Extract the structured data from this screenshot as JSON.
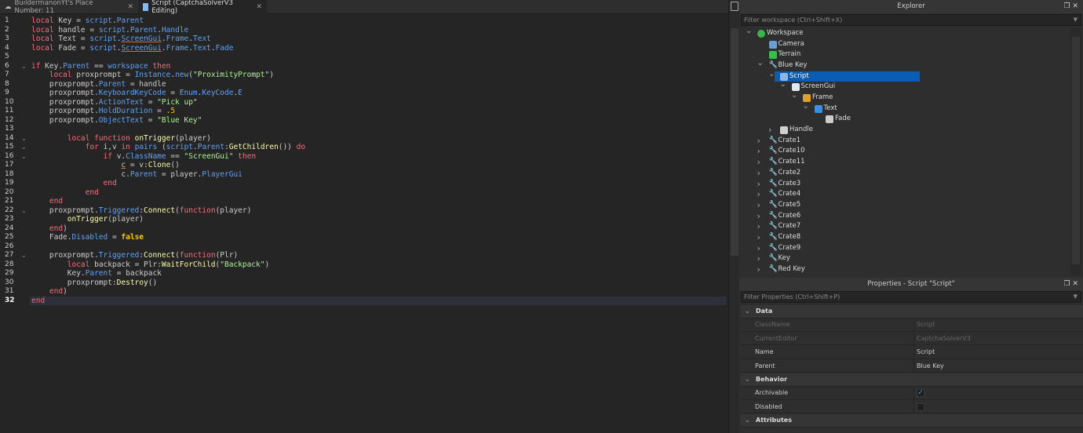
{
  "tabs": [
    {
      "label": "BuildermanonYt's Place Number: 11",
      "icon": "cloud-icon"
    },
    {
      "label": "Script (CaptchaSolverV3 Editing)",
      "icon": "script-icon",
      "active": true
    }
  ],
  "editor": {
    "current_line": 32,
    "fold_lines": [
      6,
      14,
      15,
      16,
      22,
      27
    ],
    "lines": [
      [
        [
          "local",
          "k"
        ],
        [
          " Key = ",
          "t"
        ],
        [
          "script",
          "b"
        ],
        [
          ".",
          "t"
        ],
        [
          "Parent",
          "b"
        ]
      ],
      [
        [
          "local",
          "k"
        ],
        [
          " handle = ",
          "t"
        ],
        [
          "script",
          "b"
        ],
        [
          ".",
          "t"
        ],
        [
          "Parent",
          "b"
        ],
        [
          ".",
          "t"
        ],
        [
          "Handle",
          "b"
        ]
      ],
      [
        [
          "local",
          "k"
        ],
        [
          " Text = ",
          "t"
        ],
        [
          "script",
          "b"
        ],
        [
          ".",
          "t"
        ],
        [
          "ScreenGui",
          "u"
        ],
        [
          ".",
          "t"
        ],
        [
          "Frame",
          "b"
        ],
        [
          ".",
          "t"
        ],
        [
          "Text",
          "b"
        ]
      ],
      [
        [
          "local",
          "k"
        ],
        [
          " Fade = ",
          "t"
        ],
        [
          "script",
          "b"
        ],
        [
          ".",
          "t"
        ],
        [
          "ScreenGui",
          "u"
        ],
        [
          ".",
          "t"
        ],
        [
          "Frame",
          "b"
        ],
        [
          ".",
          "t"
        ],
        [
          "Text",
          "b"
        ],
        [
          ".",
          "t"
        ],
        [
          "Fade",
          "b"
        ]
      ],
      [],
      [
        [
          "if",
          "k"
        ],
        [
          " Key.",
          "t"
        ],
        [
          "Parent",
          "b"
        ],
        [
          " == ",
          "t"
        ],
        [
          "workspace",
          "b"
        ],
        [
          " ",
          "t"
        ],
        [
          "then",
          "k"
        ]
      ],
      [
        [
          "    ",
          "t"
        ],
        [
          "local",
          "k"
        ],
        [
          " proxprompt = ",
          "t"
        ],
        [
          "Instance",
          "b"
        ],
        [
          ".",
          "t"
        ],
        [
          "new",
          "b"
        ],
        [
          "(",
          "t"
        ],
        [
          "\"ProximityPrompt\"",
          "s"
        ],
        [
          ")",
          "t"
        ]
      ],
      [
        [
          "    proxprompt.",
          "t"
        ],
        [
          "Parent",
          "b"
        ],
        [
          " = handle",
          "t"
        ]
      ],
      [
        [
          "    proxprompt.",
          "t"
        ],
        [
          "KeyboardKeyCode",
          "b"
        ],
        [
          " = ",
          "t"
        ],
        [
          "Enum",
          "b"
        ],
        [
          ".",
          "t"
        ],
        [
          "KeyCode",
          "b"
        ],
        [
          ".",
          "t"
        ],
        [
          "E",
          "b"
        ]
      ],
      [
        [
          "    proxprompt.",
          "t"
        ],
        [
          "ActionText",
          "b"
        ],
        [
          " = ",
          "t"
        ],
        [
          "\"Pick up\"",
          "s"
        ]
      ],
      [
        [
          "    proxprompt.",
          "t"
        ],
        [
          "HoldDuration",
          "b"
        ],
        [
          " = ",
          "t"
        ],
        [
          ".5",
          "n"
        ]
      ],
      [
        [
          "    proxprompt.",
          "t"
        ],
        [
          "ObjectText",
          "b"
        ],
        [
          " = ",
          "t"
        ],
        [
          "\"Blue Key\"",
          "s"
        ]
      ],
      [],
      [
        [
          "        ",
          "t"
        ],
        [
          "local",
          "k"
        ],
        [
          " ",
          "t"
        ],
        [
          "function",
          "k"
        ],
        [
          " ",
          "t"
        ],
        [
          "onTrigger",
          "y"
        ],
        [
          "(player)",
          "t"
        ]
      ],
      [
        [
          "            ",
          "t"
        ],
        [
          "for",
          "k"
        ],
        [
          " i,v ",
          "t"
        ],
        [
          "in",
          "k"
        ],
        [
          " ",
          "t"
        ],
        [
          "pairs",
          "b"
        ],
        [
          " (",
          "t"
        ],
        [
          "script",
          "b"
        ],
        [
          ".",
          "t"
        ],
        [
          "Parent",
          "b"
        ],
        [
          ":",
          "t"
        ],
        [
          "GetChildren",
          "y"
        ],
        [
          "()) ",
          "t"
        ],
        [
          "do",
          "k"
        ]
      ],
      [
        [
          "                ",
          "t"
        ],
        [
          "if",
          "k"
        ],
        [
          " v.",
          "t"
        ],
        [
          "ClassName",
          "b"
        ],
        [
          " == ",
          "t"
        ],
        [
          "\"ScreenGui\"",
          "s"
        ],
        [
          " ",
          "t"
        ],
        [
          "then",
          "k"
        ]
      ],
      [
        [
          "                    ",
          "t"
        ],
        [
          "c",
          "uo"
        ],
        [
          " = v:",
          "t"
        ],
        [
          "Clone",
          "y"
        ],
        [
          "()",
          "t"
        ]
      ],
      [
        [
          "                    c.",
          "t"
        ],
        [
          "Parent",
          "b"
        ],
        [
          " = player.",
          "t"
        ],
        [
          "PlayerGui",
          "b"
        ]
      ],
      [
        [
          "                ",
          "t"
        ],
        [
          "end",
          "k"
        ]
      ],
      [
        [
          "            ",
          "t"
        ],
        [
          "end",
          "k"
        ]
      ],
      [
        [
          "    ",
          "t"
        ],
        [
          "end",
          "k"
        ]
      ],
      [
        [
          "    proxprompt.",
          "t"
        ],
        [
          "Triggered",
          "b"
        ],
        [
          ":",
          "t"
        ],
        [
          "Connect",
          "y"
        ],
        [
          "(",
          "t"
        ],
        [
          "function",
          "k"
        ],
        [
          "(player)",
          "t"
        ]
      ],
      [
        [
          "        ",
          "t"
        ],
        [
          "onTrigger",
          "y"
        ],
        [
          "(player)",
          "t"
        ]
      ],
      [
        [
          "    ",
          "t"
        ],
        [
          "end",
          "k"
        ],
        [
          ")",
          "t"
        ]
      ],
      [
        [
          "    Fade.",
          "t"
        ],
        [
          "Disabled",
          "b"
        ],
        [
          " = ",
          "t"
        ],
        [
          "false",
          "f"
        ]
      ],
      [],
      [
        [
          "    proxprompt.",
          "t"
        ],
        [
          "Triggered",
          "b"
        ],
        [
          ":",
          "t"
        ],
        [
          "Connect",
          "y"
        ],
        [
          "(",
          "t"
        ],
        [
          "function",
          "k"
        ],
        [
          "(Plr)",
          "t"
        ]
      ],
      [
        [
          "        ",
          "t"
        ],
        [
          "local",
          "k"
        ],
        [
          " backpack = Plr:",
          "t"
        ],
        [
          "WaitForChild",
          "y"
        ],
        [
          "(",
          "t"
        ],
        [
          "\"Backpack\"",
          "s"
        ],
        [
          ")",
          "t"
        ]
      ],
      [
        [
          "        Key.",
          "t"
        ],
        [
          "Parent",
          "b"
        ],
        [
          " = backpack",
          "t"
        ]
      ],
      [
        [
          "        proxprompt:",
          "t"
        ],
        [
          "Destroy",
          "y"
        ],
        [
          "()",
          "t"
        ]
      ],
      [
        [
          "    ",
          "t"
        ],
        [
          "end",
          "k"
        ],
        [
          ")",
          "t"
        ]
      ],
      [
        [
          "end",
          "k"
        ]
      ]
    ]
  },
  "explorer": {
    "title": "Explorer",
    "filter_placeholder": "Filter workspace (Ctrl+Shift+X)",
    "items": [
      {
        "label": "Workspace",
        "depth": 0,
        "arrow": "open",
        "icon": "globe-icon",
        "color": "#3bb54a"
      },
      {
        "label": "Camera",
        "depth": 1,
        "arrow": "",
        "icon": "camera-icon",
        "color": "#6a9fd4"
      },
      {
        "label": "Terrain",
        "depth": 1,
        "arrow": "",
        "icon": "terrain-icon",
        "color": "#35c04a"
      },
      {
        "label": "Blue Key",
        "depth": 1,
        "arrow": "open",
        "icon": "tool-icon",
        "color": "#f0892e"
      },
      {
        "label": "Script",
        "depth": 2,
        "arrow": "open",
        "icon": "script-icon",
        "color": "#8db5e8",
        "selected": true
      },
      {
        "label": "ScreenGui",
        "depth": 3,
        "arrow": "open",
        "icon": "screengui-icon",
        "color": "#dfe8f2"
      },
      {
        "label": "Frame",
        "depth": 4,
        "arrow": "open",
        "icon": "frame-icon",
        "color": "#e0a030"
      },
      {
        "label": "Text",
        "depth": 5,
        "arrow": "open",
        "icon": "textlabel-icon",
        "color": "#3d8fe0"
      },
      {
        "label": "Fade",
        "depth": 6,
        "arrow": "",
        "icon": "localscript-icon",
        "color": "#cccccc"
      },
      {
        "label": "Handle",
        "depth": 2,
        "arrow": "closed",
        "icon": "part-icon",
        "color": "#d0d0d0"
      },
      {
        "label": "Crate1",
        "depth": 1,
        "arrow": "closed",
        "icon": "tool-icon",
        "color": "#f0892e"
      },
      {
        "label": "Crate10",
        "depth": 1,
        "arrow": "closed",
        "icon": "tool-icon",
        "color": "#f0892e"
      },
      {
        "label": "Crate11",
        "depth": 1,
        "arrow": "closed",
        "icon": "tool-icon",
        "color": "#f0892e"
      },
      {
        "label": "Crate2",
        "depth": 1,
        "arrow": "closed",
        "icon": "tool-icon",
        "color": "#f0892e"
      },
      {
        "label": "Crate3",
        "depth": 1,
        "arrow": "closed",
        "icon": "tool-icon",
        "color": "#f0892e"
      },
      {
        "label": "Crate4",
        "depth": 1,
        "arrow": "closed",
        "icon": "tool-icon",
        "color": "#f0892e"
      },
      {
        "label": "Crate5",
        "depth": 1,
        "arrow": "closed",
        "icon": "tool-icon",
        "color": "#f0892e"
      },
      {
        "label": "Crate6",
        "depth": 1,
        "arrow": "closed",
        "icon": "tool-icon",
        "color": "#f0892e"
      },
      {
        "label": "Crate7",
        "depth": 1,
        "arrow": "closed",
        "icon": "tool-icon",
        "color": "#f0892e"
      },
      {
        "label": "Crate8",
        "depth": 1,
        "arrow": "closed",
        "icon": "tool-icon",
        "color": "#f0892e"
      },
      {
        "label": "Crate9",
        "depth": 1,
        "arrow": "closed",
        "icon": "tool-icon",
        "color": "#f0892e"
      },
      {
        "label": "Key",
        "depth": 1,
        "arrow": "closed",
        "icon": "tool-icon",
        "color": "#f0892e"
      },
      {
        "label": "Red Key",
        "depth": 1,
        "arrow": "closed",
        "icon": "tool-icon",
        "color": "#f0892e"
      }
    ]
  },
  "properties": {
    "title": "Properties - Script \"Script\"",
    "filter_placeholder": "Filter Properties (Ctrl+Shift+P)",
    "rows": [
      {
        "type": "section",
        "name": "Data"
      },
      {
        "type": "prop",
        "name": "ClassName",
        "value": "Script",
        "dim": true
      },
      {
        "type": "prop",
        "name": "CurrentEditor",
        "value": "CaptchaSolverV3",
        "dim": true
      },
      {
        "type": "prop",
        "name": "Name",
        "value": "Script"
      },
      {
        "type": "prop",
        "name": "Parent",
        "value": "Blue Key"
      },
      {
        "type": "section",
        "name": "Behavior"
      },
      {
        "type": "check",
        "name": "Archivable",
        "checked": true
      },
      {
        "type": "check",
        "name": "Disabled",
        "checked": false
      },
      {
        "type": "section",
        "name": "Attributes"
      }
    ]
  }
}
